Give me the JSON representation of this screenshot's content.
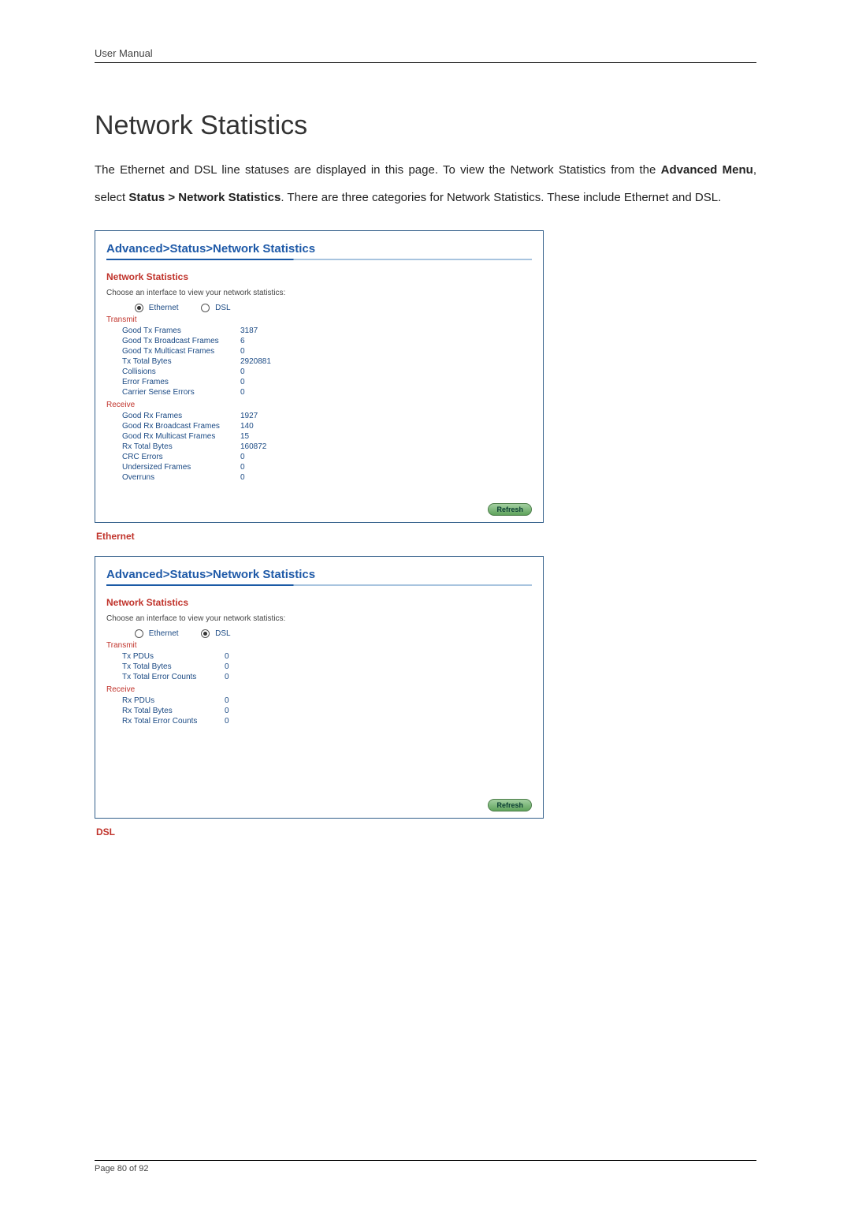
{
  "header": "User Manual",
  "title": "Network Statistics",
  "intro_parts": {
    "p1": "The Ethernet and DSL line statuses are displayed in this page. To view the Network Statistics from the ",
    "b1": "Advanced Menu",
    "p2": ", select ",
    "b2": "Status > Network Statistics",
    "p3": ". There are three categories for Network Statistics. These include Ethernet and DSL."
  },
  "panel1": {
    "breadcrumb": "Advanced>Status>Network Statistics",
    "subtitle": "Network Statistics",
    "hint": "Choose an interface to view your network statistics:",
    "radios": {
      "ethernet": "Ethernet",
      "dsl": "DSL"
    },
    "transmit_head": "Transmit",
    "transmit": [
      {
        "label": "Good Tx Frames",
        "value": "3187"
      },
      {
        "label": "Good Tx Broadcast Frames",
        "value": "6"
      },
      {
        "label": "Good Tx Multicast Frames",
        "value": "0"
      },
      {
        "label": "Tx Total Bytes",
        "value": "2920881"
      },
      {
        "label": "Collisions",
        "value": "0"
      },
      {
        "label": "Error Frames",
        "value": "0"
      },
      {
        "label": "Carrier Sense Errors",
        "value": "0"
      }
    ],
    "receive_head": "Receive",
    "receive": [
      {
        "label": "Good Rx Frames",
        "value": "1927"
      },
      {
        "label": "Good Rx Broadcast Frames",
        "value": "140"
      },
      {
        "label": "Good Rx Multicast Frames",
        "value": "15"
      },
      {
        "label": "Rx Total Bytes",
        "value": "160872"
      },
      {
        "label": "CRC Errors",
        "value": "0"
      },
      {
        "label": "Undersized Frames",
        "value": "0"
      },
      {
        "label": "Overruns",
        "value": "0"
      }
    ],
    "refresh": "Refresh"
  },
  "caption1": "Ethernet",
  "panel2": {
    "breadcrumb": "Advanced>Status>Network Statistics",
    "subtitle": "Network Statistics",
    "hint": "Choose an interface to view your network statistics:",
    "radios": {
      "ethernet": "Ethernet",
      "dsl": "DSL"
    },
    "transmit_head": "Transmit",
    "transmit": [
      {
        "label": "Tx PDUs",
        "value": "0"
      },
      {
        "label": "Tx Total Bytes",
        "value": "0"
      },
      {
        "label": "Tx Total Error Counts",
        "value": "0"
      }
    ],
    "receive_head": "Receive",
    "receive": [
      {
        "label": "Rx PDUs",
        "value": "0"
      },
      {
        "label": "Rx Total Bytes",
        "value": "0"
      },
      {
        "label": "Rx Total Error Counts",
        "value": "0"
      }
    ],
    "refresh": "Refresh"
  },
  "caption2": "DSL",
  "footer": "Page 80 of 92"
}
